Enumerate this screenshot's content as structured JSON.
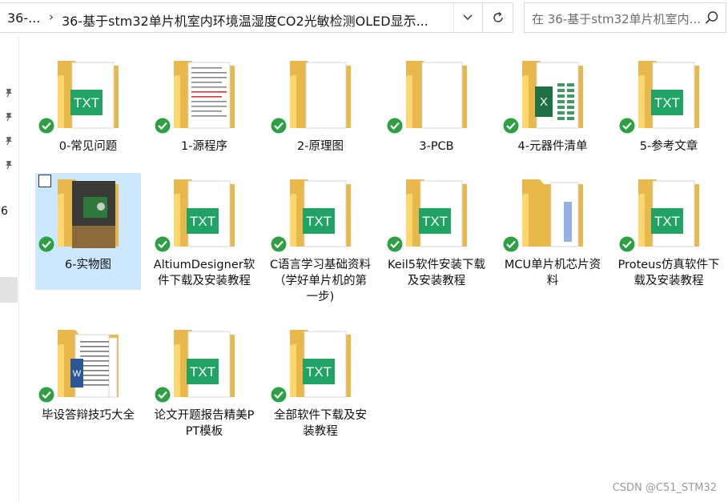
{
  "breadcrumb": {
    "parent": "36-...",
    "current": "36-基于stm32单片机室内环境温湿度CO2光敏检测OLED显示..."
  },
  "search": {
    "placeholder": "在 36-基于stm32单片机室内..."
  },
  "nav": {
    "visible_text": "6"
  },
  "items": [
    {
      "label": "0-常见问题",
      "kind": "txt"
    },
    {
      "label": "1-源程序",
      "kind": "doc"
    },
    {
      "label": "2-原理图",
      "kind": "blank"
    },
    {
      "label": "3-PCB",
      "kind": "blank"
    },
    {
      "label": "4-元器件清单",
      "kind": "xls"
    },
    {
      "label": "5-参考文章",
      "kind": "txt"
    },
    {
      "label": "6-实物图",
      "kind": "photo",
      "selected": true
    },
    {
      "label": "AltiumDesigner软件下载及安装教程",
      "kind": "txt"
    },
    {
      "label": "C语言学习基础资料（学好单片机的第一步)",
      "kind": "txt"
    },
    {
      "label": "Keil5软件安装下载及安装教程",
      "kind": "txt"
    },
    {
      "label": "MCU单片机芯片资料",
      "kind": "pages"
    },
    {
      "label": "Proteus仿真软件下载及安装教程",
      "kind": "txt"
    },
    {
      "label": "毕设答辩技巧大全",
      "kind": "word"
    },
    {
      "label": "论文开题报告精美PPT模板",
      "kind": "txt"
    },
    {
      "label": "全部软件下载及安装教程",
      "kind": "txt"
    }
  ],
  "icons": {
    "txt_badge": "TXT",
    "xls_badge": "X",
    "word_badge": "W"
  },
  "colors": {
    "folder_back": "#e8b84a",
    "folder_front": "#ffd76e",
    "txt_green": "#21a366",
    "excel_green": "#1e7145",
    "sync_green": "#2ea043",
    "selection": "#cce8ff"
  },
  "watermark": "CSDN @C51_STM32"
}
